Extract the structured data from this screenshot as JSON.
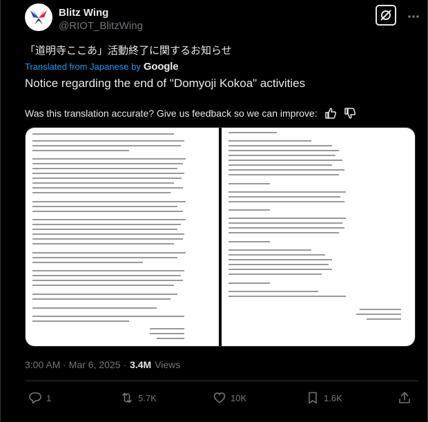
{
  "tweet": {
    "author_name": "Blitz Wing",
    "author_handle": "@RIOT_BlitzWing",
    "original_text": "「道明寺ここあ」活動終了に関するお知らせ",
    "translated_from": "Translated from Japanese by",
    "translator": "Google",
    "translation": "Notice regarding the end of \"Domyoji Kokoa\" activities",
    "feedback_prompt": "Was this translation accurate? Give us feedback so we can improve:",
    "timestamp": "3:00 AM · Mar 6, 2025 · ",
    "views_count": "3.4M",
    "views_label": " Views"
  },
  "media": {
    "page1_alt": "Announcement letter page 1",
    "page2_alt": "Announcement letter page 2"
  },
  "actions": {
    "replies": "1",
    "reposts": "5.7K",
    "likes": "10K",
    "bookmarks": "1.6K"
  },
  "colors": {
    "background": "#000000",
    "text": "#e7e9ea",
    "muted": "#71767b",
    "link": "#1d9bf0"
  }
}
